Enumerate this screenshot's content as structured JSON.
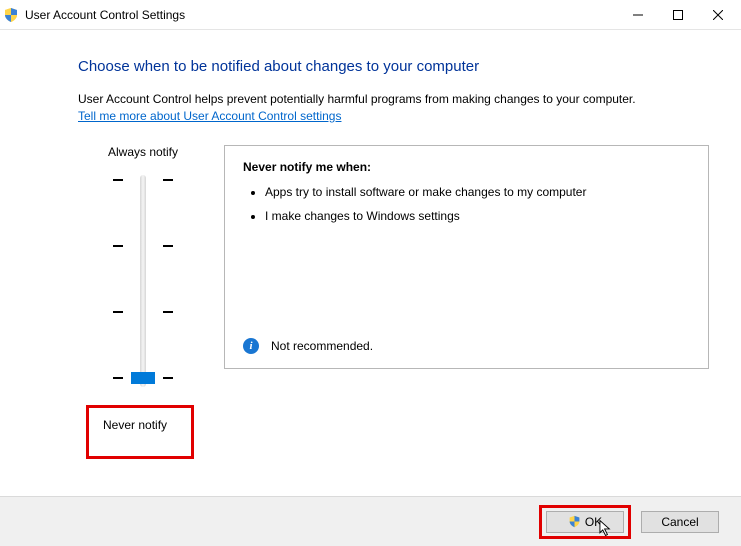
{
  "window": {
    "title": "User Account Control Settings"
  },
  "main": {
    "heading": "Choose when to be notified about changes to your computer",
    "description": "User Account Control helps prevent potentially harmful programs from making changes to your computer.",
    "link_text": "Tell me more about User Account Control settings"
  },
  "slider": {
    "top_label": "Always notify",
    "bottom_label": "Never notify",
    "position": 3,
    "levels": 4
  },
  "panel": {
    "title": "Never notify me when:",
    "items": [
      "Apps try to install software or make changes to my computer",
      "I make changes to Windows settings"
    ],
    "recommendation": "Not recommended."
  },
  "buttons": {
    "ok": "OK",
    "cancel": "Cancel"
  }
}
